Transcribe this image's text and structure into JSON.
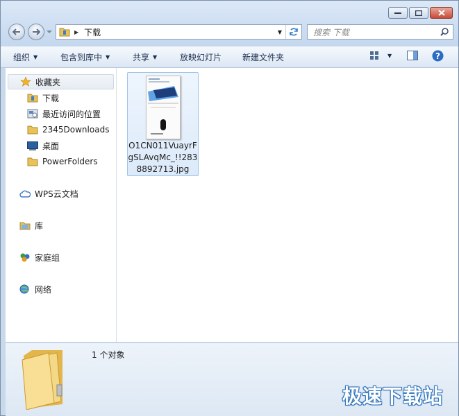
{
  "address": {
    "crumb": "下载",
    "search_placeholder": "搜索 下载"
  },
  "toolbar": {
    "organize": "组织",
    "include": "包含到库中",
    "share": "共享",
    "slideshow": "放映幻灯片",
    "new_folder": "新建文件夹"
  },
  "nav": {
    "favorites": "收藏夹",
    "fav_items": [
      "下载",
      "最近访问的位置",
      "2345Downloads",
      "桌面",
      "PowerFolders"
    ],
    "wps": "WPS云文档",
    "library": "库",
    "homegroup": "家庭组",
    "network": "网络"
  },
  "file": {
    "name": "O1CN011VuayrFgSLAvqMc_!!2838892713.jpg"
  },
  "details": {
    "count": "1 个对象"
  },
  "watermark": "极速下载站"
}
